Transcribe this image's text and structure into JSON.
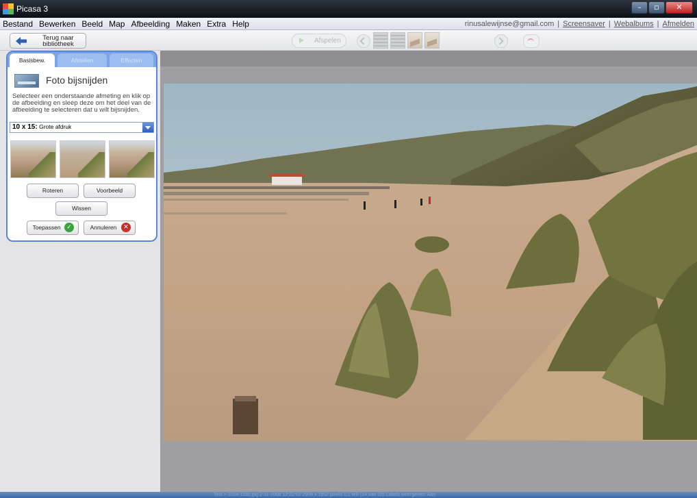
{
  "window": {
    "title": "Picasa 3",
    "controls": [
      "minimize",
      "maximize",
      "close"
    ]
  },
  "menubar": {
    "items": [
      "Bestand",
      "Bewerken",
      "Beeld",
      "Map",
      "Afbeelding",
      "Maken",
      "Extra",
      "Help"
    ],
    "account_email": "rinusalewijnse@gmail.com",
    "links": [
      "Screensaver",
      "Webalbums",
      "Afmelden"
    ]
  },
  "toolbar": {
    "back_label_line1": "Terug naar",
    "back_label_line2": "bibliotheek",
    "play_label": "Afspelen"
  },
  "panel": {
    "tabs": [
      "Basisbew.",
      "Afstellen",
      "Effecten"
    ],
    "title": "Foto bijsnijden",
    "instructions": "Selecteer een onderstaande afmeting en klik op de afbeelding en sleep deze om het deel van de afbeelding te selecteren dat u wilt bijsnijden.",
    "aspect_size": "10 x 15:",
    "aspect_name": "Grote afdruk",
    "buttons": {
      "rotate": "Roteren",
      "preview": "Voorbeeld",
      "clear": "Wissen",
      "apply": "Toepassen",
      "cancel": "Annuleren"
    }
  },
  "status": {
    "text": "Test > 2008-1192.jpg     2-11-2008 12:22:02     2908 x 1952 pixels     1,1 MB     (14 van 18)     Labels weergeven: Aan"
  },
  "colors": {
    "accent": "#5a86d6",
    "tab_bar": "#7da4e6",
    "apply_icon": "#3aa33d",
    "cancel_icon": "#c2312b",
    "viewer_bg": "#9f9fa2"
  }
}
